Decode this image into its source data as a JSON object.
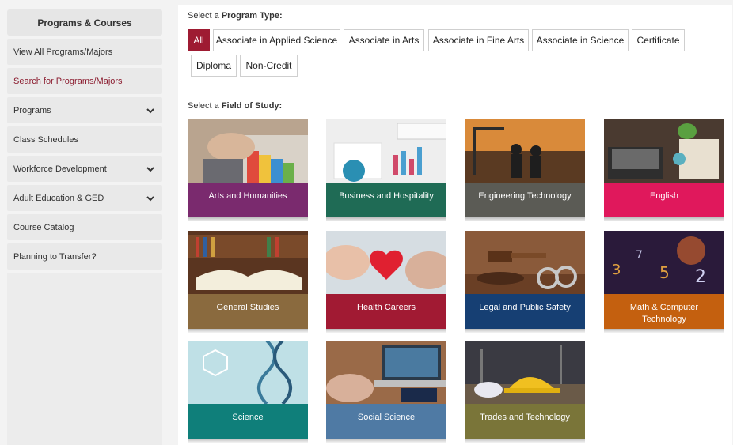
{
  "sidebar": {
    "header": "Programs & Courses",
    "items": [
      {
        "label": "View All Programs/Majors"
      },
      {
        "label": "Search for Programs/Majors"
      },
      {
        "label": "Programs"
      },
      {
        "label": "Class Schedules"
      },
      {
        "label": "Workforce Development"
      },
      {
        "label": "Adult Education & GED"
      },
      {
        "label": "Course Catalog"
      },
      {
        "label": "Planning to Transfer?"
      }
    ]
  },
  "program_type": {
    "prefix": "Select a ",
    "bold": "Program Type:",
    "buttons": [
      "All",
      "Associate in Applied Science",
      "Associate in Arts",
      "Associate in Fine Arts",
      "Associate in Science",
      "Certificate",
      "Diploma",
      "Non-Credit"
    ],
    "selected": "All"
  },
  "field_of_study": {
    "prefix": "Select a ",
    "bold": "Field of Study:",
    "cards": [
      {
        "label": "Arts and Humanities",
        "color": "#7a2a6e"
      },
      {
        "label": "Business and Hospitality",
        "color": "#1f6b55"
      },
      {
        "label": "Engineering Technology",
        "color": "#5b5b55"
      },
      {
        "label": "English",
        "color": "#e0185c"
      },
      {
        "label": "General Studies",
        "color": "#8a6a3e"
      },
      {
        "label": "Health Careers",
        "color": "#a11a33"
      },
      {
        "label": "Legal and Public Safety",
        "color": "#163f73"
      },
      {
        "label": "Math & Computer Technology",
        "color": "#c4600f"
      },
      {
        "label": "Science",
        "color": "#0f7f7a"
      },
      {
        "label": "Social Science",
        "color": "#4f7aa4"
      },
      {
        "label": "Trades and Technology",
        "color": "#7a7539"
      }
    ]
  },
  "colors": {
    "accent": "#9e1b32"
  }
}
